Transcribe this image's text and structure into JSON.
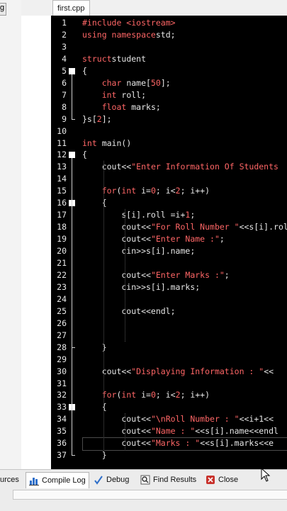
{
  "left_tab": {
    "label": "g"
  },
  "editor_tab": {
    "label": "first.cpp"
  },
  "code": [
    {
      "n": "1",
      "parts": [
        [
          "pp",
          "#include <iostream>"
        ]
      ]
    },
    {
      "n": "2",
      "parts": [
        [
          "kw",
          "using namespace"
        ],
        [
          "",
          "std;"
        ]
      ]
    },
    {
      "n": "3",
      "parts": []
    },
    {
      "n": "4",
      "parts": [
        [
          "kw",
          "struct"
        ],
        [
          "",
          "student"
        ]
      ]
    },
    {
      "n": "5",
      "parts": [
        [
          "",
          "{"
        ]
      ]
    },
    {
      "n": "6",
      "parts": [
        [
          "",
          "    "
        ],
        [
          "ty",
          "char"
        ],
        [
          "",
          " name["
        ],
        [
          "num",
          "50"
        ],
        [
          "",
          "];"
        ]
      ]
    },
    {
      "n": "7",
      "parts": [
        [
          "",
          "    "
        ],
        [
          "ty",
          "int"
        ],
        [
          "",
          " roll;"
        ]
      ]
    },
    {
      "n": "8",
      "parts": [
        [
          "",
          "    "
        ],
        [
          "ty",
          "float"
        ],
        [
          "",
          " marks;"
        ]
      ]
    },
    {
      "n": "9",
      "parts": [
        [
          "",
          "}s["
        ],
        [
          "num",
          "2"
        ],
        [
          "",
          "];"
        ]
      ]
    },
    {
      "n": "10",
      "parts": []
    },
    {
      "n": "11",
      "parts": [
        [
          "ty",
          "int"
        ],
        [
          "",
          " main()"
        ]
      ]
    },
    {
      "n": "12",
      "parts": [
        [
          "",
          "{"
        ]
      ]
    },
    {
      "n": "13",
      "parts": [
        [
          "",
          "    cout<<"
        ],
        [
          "st",
          "\"Enter Information Of Students"
        ]
      ]
    },
    {
      "n": "14",
      "parts": []
    },
    {
      "n": "15",
      "parts": [
        [
          "",
          "    "
        ],
        [
          "kw",
          "for"
        ],
        [
          "",
          "("
        ],
        [
          "ty",
          "int"
        ],
        [
          "",
          " i="
        ],
        [
          "num",
          "0"
        ],
        [
          "",
          "; i<"
        ],
        [
          "num",
          "2"
        ],
        [
          "",
          "; i++)"
        ]
      ]
    },
    {
      "n": "16",
      "parts": [
        [
          "",
          "    {"
        ]
      ]
    },
    {
      "n": "17",
      "parts": [
        [
          "",
          "        s[i].roll =i+"
        ],
        [
          "num",
          "1"
        ],
        [
          "",
          ";"
        ]
      ]
    },
    {
      "n": "18",
      "parts": [
        [
          "",
          "        cout<<"
        ],
        [
          "st",
          "\"For Roll Number \""
        ],
        [
          "",
          "<<s[i].roll"
        ]
      ]
    },
    {
      "n": "19",
      "parts": [
        [
          "",
          "        cout<<"
        ],
        [
          "st",
          "\"Enter Name :\""
        ],
        [
          "",
          ";"
        ]
      ]
    },
    {
      "n": "20",
      "parts": [
        [
          "",
          "        cin>>s[i].name;"
        ]
      ]
    },
    {
      "n": "21",
      "parts": []
    },
    {
      "n": "22",
      "parts": [
        [
          "",
          "        cout<<"
        ],
        [
          "st",
          "\"Enter Marks :\""
        ],
        [
          "",
          ";"
        ]
      ]
    },
    {
      "n": "23",
      "parts": [
        [
          "",
          "        cin>>s[i].marks;"
        ]
      ]
    },
    {
      "n": "24",
      "parts": []
    },
    {
      "n": "25",
      "parts": [
        [
          "",
          "        cout<<endl;"
        ]
      ]
    },
    {
      "n": "26",
      "parts": []
    },
    {
      "n": "27",
      "parts": []
    },
    {
      "n": "28",
      "parts": [
        [
          "",
          "    }"
        ]
      ]
    },
    {
      "n": "29",
      "parts": []
    },
    {
      "n": "30",
      "parts": [
        [
          "",
          "    cout<<"
        ],
        [
          "st",
          "\"Displaying Information : \""
        ],
        [
          "",
          "<<"
        ]
      ]
    },
    {
      "n": "31",
      "parts": []
    },
    {
      "n": "32",
      "parts": [
        [
          "",
          "    "
        ],
        [
          "kw",
          "for"
        ],
        [
          "",
          "("
        ],
        [
          "ty",
          "int"
        ],
        [
          "",
          " i="
        ],
        [
          "num",
          "0"
        ],
        [
          "",
          "; i<"
        ],
        [
          "num",
          "2"
        ],
        [
          "",
          "; i++)"
        ]
      ]
    },
    {
      "n": "33",
      "parts": [
        [
          "",
          "    {"
        ]
      ]
    },
    {
      "n": "34",
      "parts": [
        [
          "",
          "        cout<<"
        ],
        [
          "st",
          "\"\\nRoll Number : \""
        ],
        [
          "",
          "<<i+1<<"
        ]
      ]
    },
    {
      "n": "35",
      "parts": [
        [
          "",
          "        cout<<"
        ],
        [
          "st",
          "\"Name : \""
        ],
        [
          "",
          "<<s[i].name<<endl"
        ]
      ]
    },
    {
      "n": "36",
      "parts": [
        [
          "",
          "        cout<<"
        ],
        [
          "st",
          "\"Marks : \""
        ],
        [
          "",
          "<<s[i].marks<<e"
        ]
      ]
    },
    {
      "n": "37",
      "parts": [
        [
          "",
          "    }"
        ]
      ]
    }
  ],
  "bottom_tabs": [
    {
      "label": "urces",
      "icon": "resources-icon"
    },
    {
      "label": "Compile Log",
      "icon": "compile-log-icon"
    },
    {
      "label": "Debug",
      "icon": "debug-icon"
    },
    {
      "label": "Find Results",
      "icon": "find-results-icon"
    },
    {
      "label": "Close",
      "icon": "close-icon"
    }
  ]
}
